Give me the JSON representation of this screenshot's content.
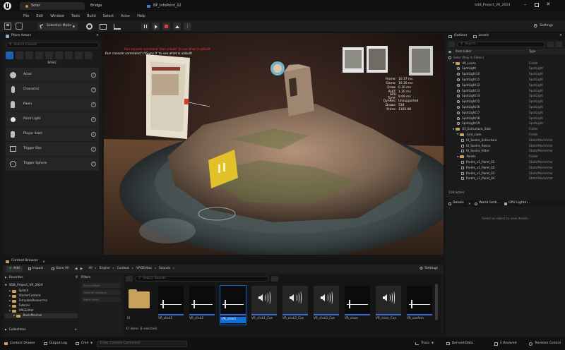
{
  "app": {
    "logo": "ue-logo-icon",
    "project_name": "SGB_Project_VR_2024",
    "tabs": [
      {
        "label": "Solar"
      },
      {
        "label": "Bridge"
      },
      {
        "label": "BP_InfoPoint_02"
      }
    ]
  },
  "menu": [
    "File",
    "Edit",
    "Window",
    "Tools",
    "Build",
    "Select",
    "Actor",
    "Help"
  ],
  "toolbar": {
    "mode_label": "Selection Mode",
    "settings_label": "Settings"
  },
  "place_actors": {
    "title": "Place Actors",
    "search_placeholder": "Search Classes",
    "category": "BASIC",
    "items": [
      {
        "label": "Actor",
        "icon": "actor-icon"
      },
      {
        "label": "Character",
        "icon": "character-icon"
      },
      {
        "label": "Pawn",
        "icon": "pawn-icon"
      },
      {
        "label": "Point Light",
        "icon": "point-light-icon"
      },
      {
        "label": "Player Start",
        "icon": "player-start-icon"
      },
      {
        "label": "Trigger Box",
        "icon": "trigger-box-icon"
      },
      {
        "label": "Trigger Sphere",
        "icon": "trigger-sphere-icon"
      }
    ]
  },
  "viewport": {
    "console_line1": "Run console command 'r.VSync 0' to see what is unbuilt",
    "console_line2": "Run console command 'stat unbuilt' to see what is unbuilt",
    "stats": [
      {
        "k": "Frame:",
        "v": "10.37 ms"
      },
      {
        "k": "Game:",
        "v": "10.30 ms"
      },
      {
        "k": "Draw:",
        "v": "0.30 ms"
      },
      {
        "k": "RHIT:",
        "v": "1.20 ms"
      },
      {
        "k": "GPU Time:",
        "v": "9.09 ms"
      },
      {
        "k": "DynRes:",
        "v": "Unsupported"
      },
      {
        "k": "Draws:",
        "v": "518"
      },
      {
        "k": "Prims:",
        "v": "1165.6K"
      }
    ]
  },
  "outliner": {
    "tabs": [
      "Outliner",
      "Levels"
    ],
    "search_placeholder": "Search...",
    "col_label": "Item Label",
    "col_type": "Type",
    "rows": [
      {
        "label": "Solar (Play In Editor)",
        "type": "",
        "kind": "world",
        "indent": 0
      },
      {
        "label": "00_Luces",
        "type": "Folder",
        "kind": "folder",
        "indent": 1
      },
      {
        "label": "SpotLight",
        "type": "SpotLight",
        "kind": "light",
        "indent": 2
      },
      {
        "label": "SpotLight10",
        "type": "SpotLight",
        "kind": "light",
        "indent": 2
      },
      {
        "label": "SpotLight11",
        "type": "SpotLight",
        "kind": "light",
        "indent": 2
      },
      {
        "label": "SpotLight12",
        "type": "SpotLight",
        "kind": "light",
        "indent": 2
      },
      {
        "label": "SpotLight13",
        "type": "SpotLight",
        "kind": "light",
        "indent": 2
      },
      {
        "label": "SpotLight14",
        "type": "SpotLight",
        "kind": "light",
        "indent": 2
      },
      {
        "label": "SpotLight15",
        "type": "SpotLight",
        "kind": "light",
        "indent": 2
      },
      {
        "label": "SpotLight16",
        "type": "SpotLight",
        "kind": "light",
        "indent": 2
      },
      {
        "label": "SpotLight17",
        "type": "SpotLight",
        "kind": "light",
        "indent": 2
      },
      {
        "label": "SpotLight18",
        "type": "SpotLight",
        "kind": "light",
        "indent": 2
      },
      {
        "label": "SpotLight19",
        "type": "SpotLight",
        "kind": "light",
        "indent": 2
      },
      {
        "label": "03_Estructura_Sala",
        "type": "Folder",
        "kind": "folder",
        "indent": 1
      },
      {
        "label": "Grid_Llam",
        "type": "Folder",
        "kind": "folder",
        "indent": 2
      },
      {
        "label": "UI_Sostre_Estructura",
        "type": "StaticMeshActor",
        "kind": "mesh",
        "indent": 3
      },
      {
        "label": "UI_Sostre_Resca",
        "type": "StaticMeshActor",
        "kind": "mesh",
        "indent": 3
      },
      {
        "label": "UI_Sostre_Vidre",
        "type": "StaticMeshActor",
        "kind": "mesh",
        "indent": 3
      },
      {
        "label": "Parets",
        "type": "Folder",
        "kind": "folder",
        "indent": 2
      },
      {
        "label": "Parets_v1_Paret_01",
        "type": "StaticMeshActor",
        "kind": "mesh",
        "indent": 3
      },
      {
        "label": "Parets_v1_Paret_02",
        "type": "StaticMeshActor",
        "kind": "mesh",
        "indent": 3
      },
      {
        "label": "Parets_v1_Paret_03",
        "type": "StaticMeshActor",
        "kind": "mesh",
        "indent": 3
      },
      {
        "label": "Parets_v1_Paret_04",
        "type": "StaticMeshActor",
        "kind": "mesh",
        "indent": 3
      }
    ],
    "count": "118 actors"
  },
  "details": {
    "tabs": [
      "Details",
      "World Setti...",
      "GPU Lightm..."
    ],
    "empty_text": "Select an object to view details."
  },
  "content_browser": {
    "title": "Content Browser",
    "add_label": "Add",
    "import_label": "Import",
    "save_all_label": "Save All",
    "settings_label": "Settings",
    "path": [
      "All",
      "Engine",
      "Content",
      "VRGEditor",
      "Sounds"
    ],
    "favorites_label": "Favorites",
    "project_label": "SGB_Project_VR_2024",
    "tree": [
      {
        "label": "Splash",
        "indent": 1
      },
      {
        "label": "StarterContent",
        "indent": 1
      },
      {
        "label": "TemplateResources",
        "indent": 1
      },
      {
        "label": "Tutorial",
        "indent": 1
      },
      {
        "label": "VRGEditor",
        "indent": 1
      },
      {
        "label": "BasicMeshes",
        "indent": 2
      }
    ],
    "collections_label": "Collections",
    "filters_label": "Filters",
    "filter_items": [
      "Sound Wave",
      "Material Instance",
      "Static Mesh"
    ],
    "search_placeholder": "Search Sounds",
    "assets": [
      {
        "label": "UI",
        "kind": "folder"
      },
      {
        "label": "VR_click1",
        "kind": "wave"
      },
      {
        "label": "VR_click2",
        "kind": "wave"
      },
      {
        "label": "VR_click3",
        "kind": "wave-selected"
      },
      {
        "label": "VR_click1_Cue",
        "kind": "cue"
      },
      {
        "label": "VR_click2_Cue",
        "kind": "cue"
      },
      {
        "label": "VR_click3_Cue",
        "kind": "cue"
      },
      {
        "label": "VR_close",
        "kind": "wave"
      },
      {
        "label": "VR_close_Cue",
        "kind": "cue"
      },
      {
        "label": "VR_confirm",
        "kind": "wave"
      }
    ],
    "status": "47 items (1 selected)"
  },
  "statusbar": {
    "content_drawer": "Content Drawer",
    "output_log": "Output Log",
    "cmd": "Cmd",
    "console_placeholder": "Enter Console Command",
    "trace": "Trace",
    "derived_data": "Derived Data",
    "unsaved": "3 Unsaved",
    "revision_control": "Revision Control"
  },
  "colors": {
    "accent_blue": "#0f6fd6",
    "selection_blue": "#0b63c7",
    "folder": "#c9a15a",
    "play_green": "#39c24a",
    "stop_red": "#e43b3b",
    "yellow_card": "#e2c12b"
  }
}
